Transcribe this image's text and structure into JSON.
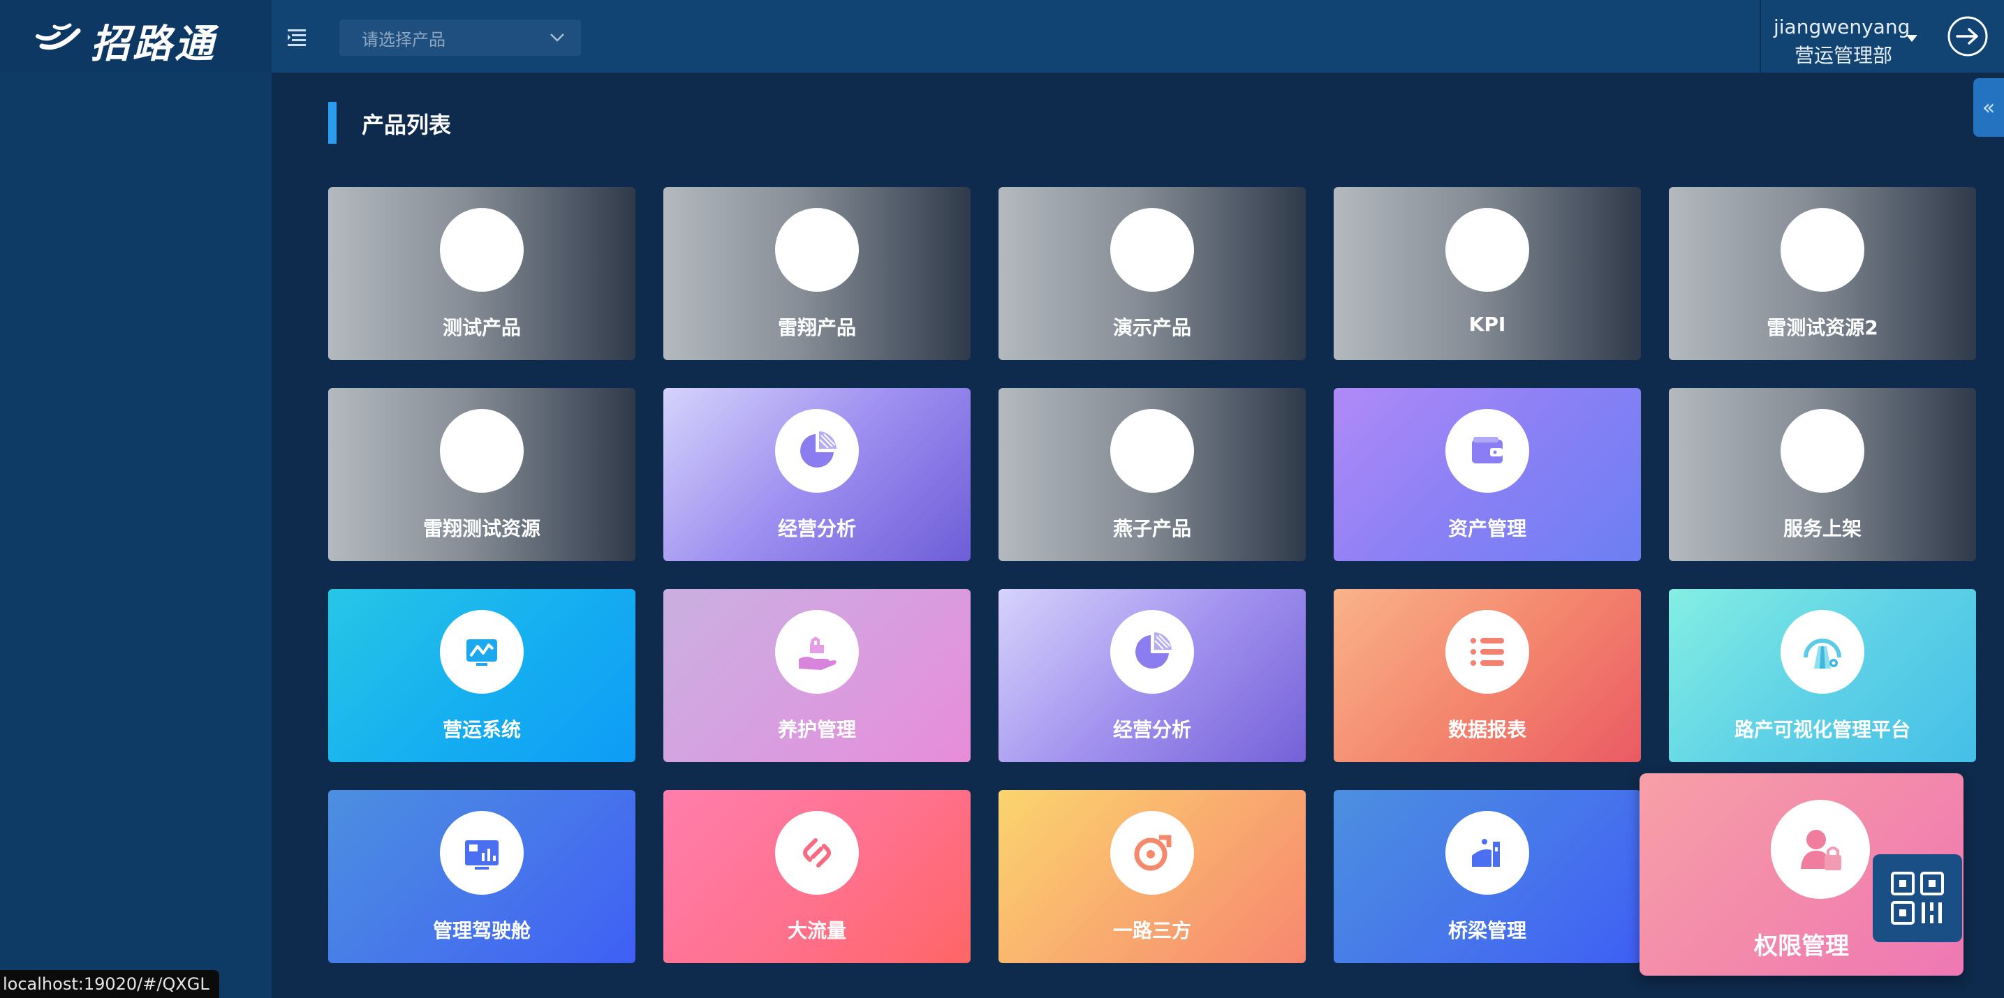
{
  "app": {
    "logo_text": "招路通"
  },
  "header": {
    "product_select_placeholder": "请选择产品",
    "user_name": "jiangwenyang",
    "user_department": "营运管理部"
  },
  "section": {
    "title": "产品列表"
  },
  "products": [
    {
      "label": "测试产品",
      "icon": "blank-circle"
    },
    {
      "label": "雷翔产品",
      "icon": "blank-circle"
    },
    {
      "label": "演示产品",
      "icon": "blank-circle"
    },
    {
      "label": "KPI",
      "icon": "blank-circle"
    },
    {
      "label": "雷测试资源2",
      "icon": "blank-circle"
    },
    {
      "label": "雷翔测试资源",
      "icon": "blank-circle"
    },
    {
      "label": "经营分析",
      "icon": "pie-chart-icon"
    },
    {
      "label": "燕子产品",
      "icon": "blank-circle"
    },
    {
      "label": "资产管理",
      "icon": "wallet-icon"
    },
    {
      "label": "服务上架",
      "icon": "blank-circle"
    },
    {
      "label": "营运系统",
      "icon": "monitor-chart-icon"
    },
    {
      "label": "养护管理",
      "icon": "hand-care-icon"
    },
    {
      "label": "经营分析",
      "icon": "pie-chart-icon"
    },
    {
      "label": "数据报表",
      "icon": "list-icon"
    },
    {
      "label": "路产可视化管理平台",
      "icon": "road-gauge-icon"
    },
    {
      "label": "管理驾驶舱",
      "icon": "dashboard-icon"
    },
    {
      "label": "大流量",
      "icon": "link-icon"
    },
    {
      "label": "一路三方",
      "icon": "ring-icon"
    },
    {
      "label": "桥梁管理",
      "icon": "bridge-icon"
    },
    {
      "label": "权限管理",
      "icon": "user-lock-icon"
    }
  ],
  "status_bar": {
    "url": "localhost:19020/#/QXGL"
  },
  "colors": {
    "topbar": "#114373",
    "sidebar": "#0e3a66",
    "content": "#0e2a4c",
    "accent": "#2b9df1"
  }
}
